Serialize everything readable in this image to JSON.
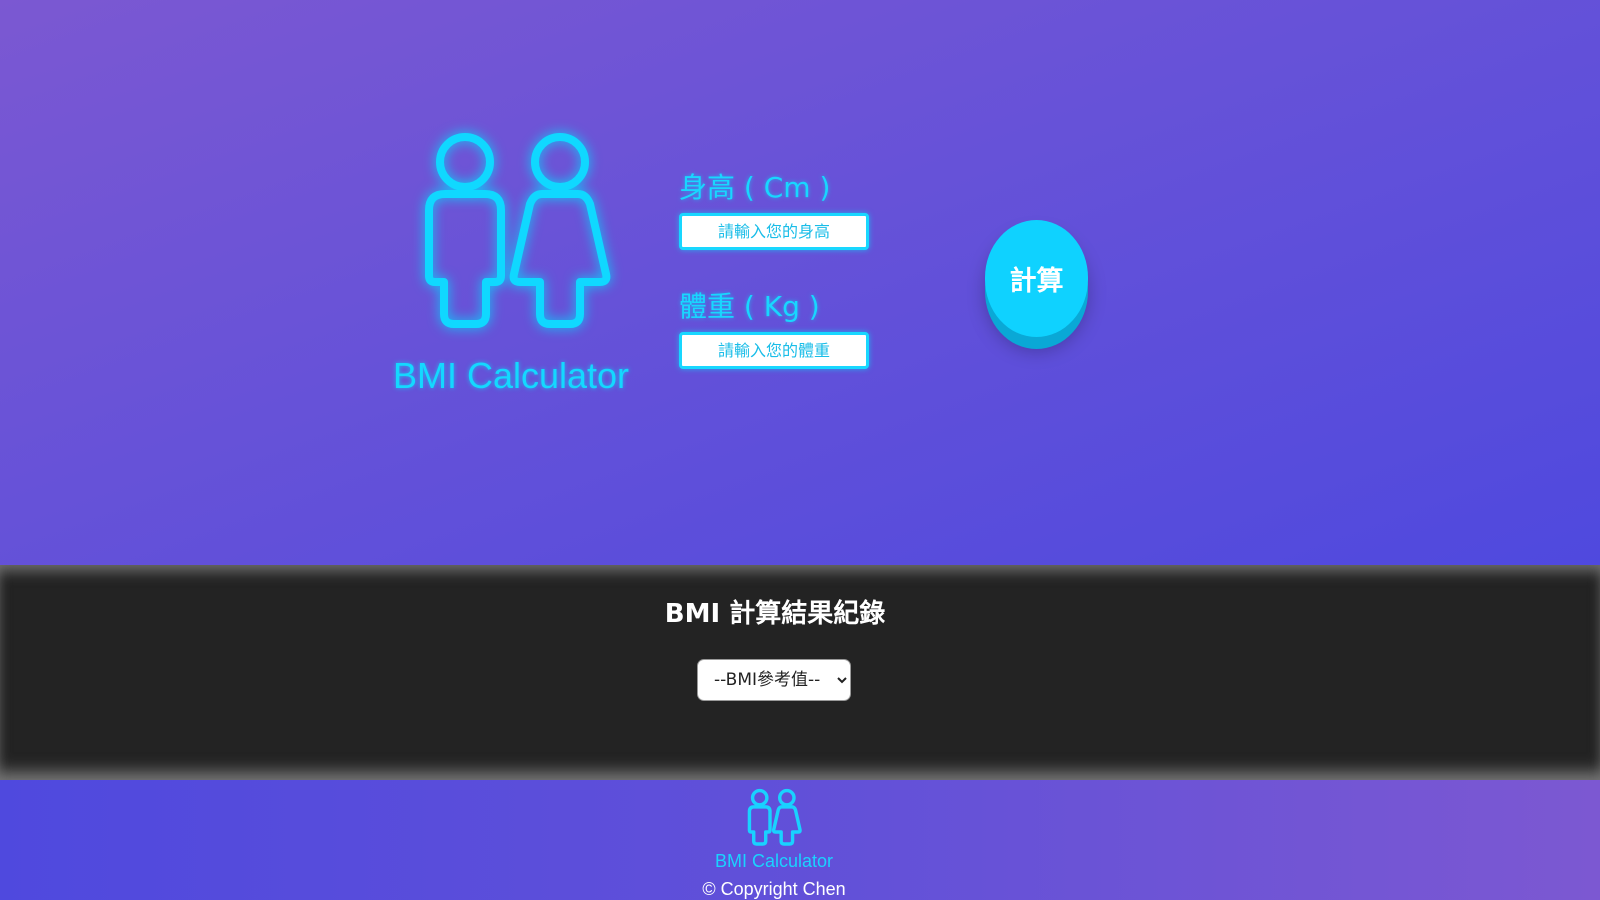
{
  "hero": {
    "logo_text": "BMI Calculator",
    "height_label": "身高 ( Cm )",
    "height_placeholder": "請輸入您的身高",
    "weight_label": "體重 ( Kg )",
    "weight_placeholder": "請輸入您的體重",
    "calculate_label": "計算",
    "logo_icon": "male-female-figures-icon"
  },
  "records": {
    "title": "BMI 計算結果紀錄",
    "select_options": [
      "--BMI參考值--"
    ],
    "select_selected": "--BMI參考值--"
  },
  "footer": {
    "logo_text": "BMI Calculator",
    "copyright": "© Copyright Chen"
  },
  "colors": {
    "accent": "#14d8ff",
    "records_bg": "#232323",
    "gradient_start": "#7b58d2",
    "gradient_end": "#4f49de"
  }
}
